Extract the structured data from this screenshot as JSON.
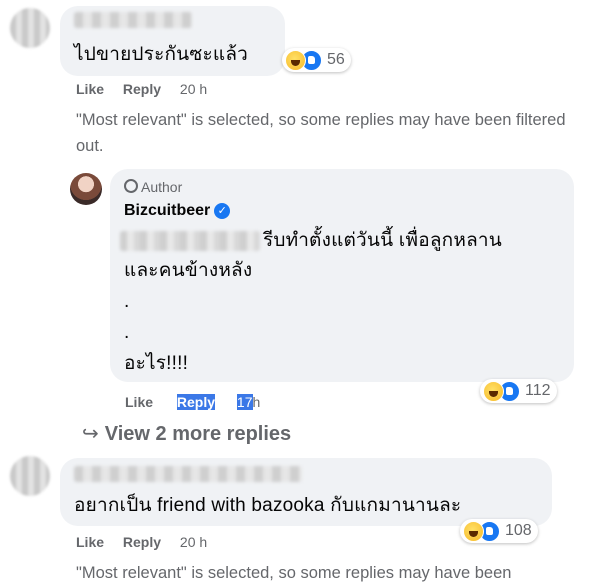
{
  "comment1": {
    "text": "ไปขายประกันซะแล้ว",
    "reaction_count": "56",
    "actions": {
      "like": "Like",
      "reply": "Reply",
      "time": "20 h"
    },
    "notice": "\"Most relevant\" is selected, so some replies may have been filtered out."
  },
  "reply1": {
    "author_badge": "Author",
    "author_name": "Bizcuitbeer",
    "text_line1_visible": "รีบทำตั้งแต่วันนี้ เพื่อลูกหลาน",
    "text_line2": "และคนข้างหลัง",
    "dot1": ".",
    "dot2": ".",
    "text_line5": "อะไร!!!!",
    "reaction_count": "112",
    "actions": {
      "like": "Like",
      "reply": "Reply",
      "time_num": "17",
      "time_unit": "h"
    }
  },
  "view_more": {
    "label": "View 2 more replies"
  },
  "comment2": {
    "text": "อยากเป็น friend with bazooka กับแกมานานละ",
    "reaction_count": "108",
    "actions": {
      "like": "Like",
      "reply": "Reply",
      "time": "20 h"
    },
    "notice": "\"Most relevant\" is selected, so some replies may have been"
  }
}
